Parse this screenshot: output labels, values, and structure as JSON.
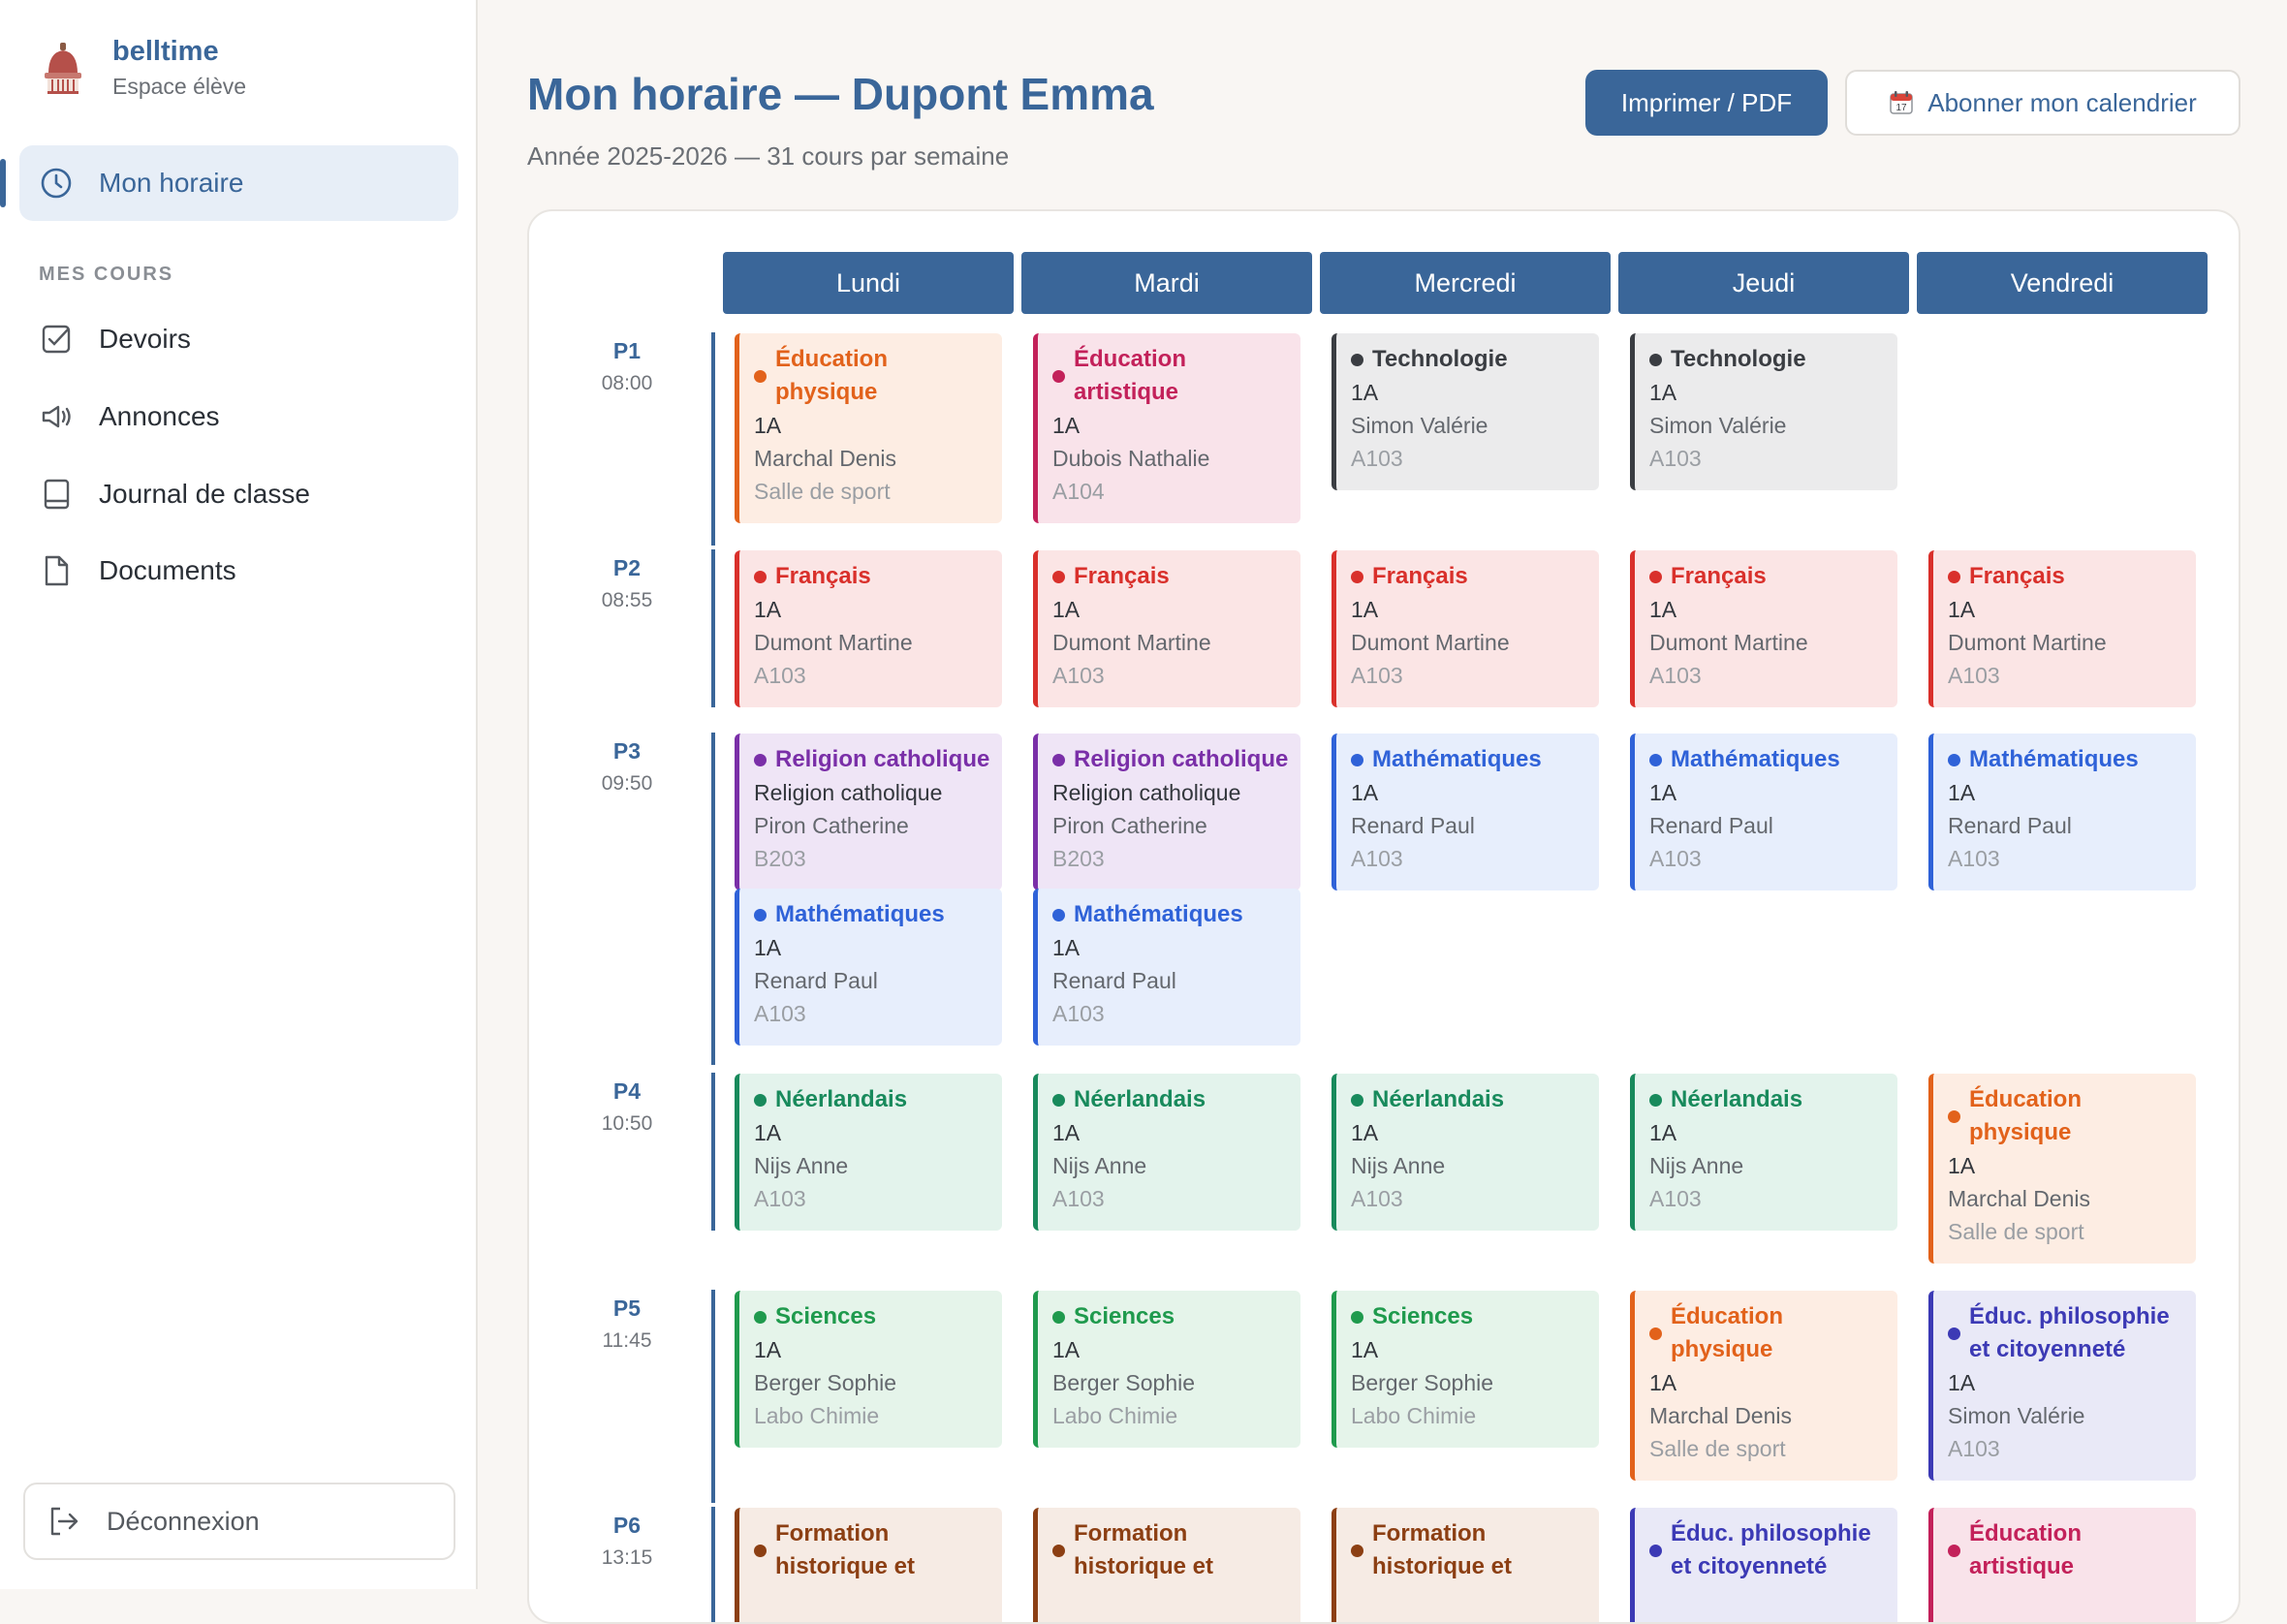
{
  "sidebar": {
    "brand_name": "belltime",
    "brand_sub": "Espace élève",
    "active_item": {
      "label": "Mon horaire",
      "icon": "clock-icon"
    },
    "section_title": "MES COURS",
    "items": [
      {
        "label": "Devoirs",
        "icon": "checkbox-icon"
      },
      {
        "label": "Annonces",
        "icon": "megaphone-icon"
      },
      {
        "label": "Journal de classe",
        "icon": "book-icon"
      },
      {
        "label": "Documents",
        "icon": "document-icon"
      }
    ],
    "logout_label": "Déconnexion"
  },
  "header": {
    "title": "Mon horaire — Dupont Emma",
    "subtitle": "Année 2025-2026 — 31 cours par semaine",
    "print_button": "Imprimer / PDF",
    "subscribe_button": "Abonner mon calendrier"
  },
  "colors": {
    "primary": "#3a6699",
    "orange": "#e2621b",
    "magenta": "#c3215a",
    "dark": "#3a3d42",
    "red": "#d9302b",
    "purple": "#7a2fa8",
    "blue": "#2f62d8",
    "green": "#188a5c",
    "lightgreen": "#1f9a4d",
    "indigo": "#3c3ab5",
    "brown": "#8c3f13"
  },
  "days": [
    "Lundi",
    "Mardi",
    "Mercredi",
    "Jeudi",
    "Vendredi"
  ],
  "periods": [
    {
      "code": "P1",
      "time": "08:00"
    },
    {
      "code": "P2",
      "time": "08:55"
    },
    {
      "code": "P3",
      "time": "09:50"
    },
    {
      "code": "P4",
      "time": "10:50"
    },
    {
      "code": "P5",
      "time": "11:45"
    },
    {
      "code": "P6",
      "time": "13:15"
    }
  ],
  "courses": [
    {
      "day": 0,
      "period": 0,
      "title_lines": [
        "Éducation",
        "physique"
      ],
      "group": "1A",
      "teacher": "Marchal Denis",
      "room": "Salle de sport",
      "color": "orange"
    },
    {
      "day": 1,
      "period": 0,
      "title_lines": [
        "Éducation",
        "artistique"
      ],
      "group": "1A",
      "teacher": "Dubois Nathalie",
      "room": "A104",
      "color": "magenta"
    },
    {
      "day": 2,
      "period": 0,
      "title_lines": [
        "Technologie"
      ],
      "group": "1A",
      "teacher": "Simon Valérie",
      "room": "A103",
      "color": "dark"
    },
    {
      "day": 3,
      "period": 0,
      "title_lines": [
        "Technologie"
      ],
      "group": "1A",
      "teacher": "Simon Valérie",
      "room": "A103",
      "color": "dark"
    },
    {
      "day": 0,
      "period": 1,
      "title_lines": [
        "Français"
      ],
      "group": "1A",
      "teacher": "Dumont Martine",
      "room": "A103",
      "color": "red"
    },
    {
      "day": 1,
      "period": 1,
      "title_lines": [
        "Français"
      ],
      "group": "1A",
      "teacher": "Dumont Martine",
      "room": "A103",
      "color": "red"
    },
    {
      "day": 2,
      "period": 1,
      "title_lines": [
        "Français"
      ],
      "group": "1A",
      "teacher": "Dumont Martine",
      "room": "A103",
      "color": "red"
    },
    {
      "day": 3,
      "period": 1,
      "title_lines": [
        "Français"
      ],
      "group": "1A",
      "teacher": "Dumont Martine",
      "room": "A103",
      "color": "red"
    },
    {
      "day": 4,
      "period": 1,
      "title_lines": [
        "Français"
      ],
      "group": "1A",
      "teacher": "Dumont Martine",
      "room": "A103",
      "color": "red"
    },
    {
      "day": 0,
      "period": 2,
      "title_lines": [
        "Religion catholique"
      ],
      "group": "Religion catholique",
      "teacher": "Piron Catherine",
      "room": "B203",
      "color": "purple"
    },
    {
      "day": 1,
      "period": 2,
      "title_lines": [
        "Religion catholique"
      ],
      "group": "Religion catholique",
      "teacher": "Piron Catherine",
      "room": "B203",
      "color": "purple"
    },
    {
      "day": 0,
      "period": 2,
      "slot": 1,
      "title_lines": [
        "Mathématiques"
      ],
      "group": "1A",
      "teacher": "Renard Paul",
      "room": "A103",
      "color": "blue"
    },
    {
      "day": 1,
      "period": 2,
      "slot": 1,
      "title_lines": [
        "Mathématiques"
      ],
      "group": "1A",
      "teacher": "Renard Paul",
      "room": "A103",
      "color": "blue"
    },
    {
      "day": 2,
      "period": 2,
      "title_lines": [
        "Mathématiques"
      ],
      "group": "1A",
      "teacher": "Renard Paul",
      "room": "A103",
      "color": "blue"
    },
    {
      "day": 3,
      "period": 2,
      "title_lines": [
        "Mathématiques"
      ],
      "group": "1A",
      "teacher": "Renard Paul",
      "room": "A103",
      "color": "blue"
    },
    {
      "day": 4,
      "period": 2,
      "title_lines": [
        "Mathématiques"
      ],
      "group": "1A",
      "teacher": "Renard Paul",
      "room": "A103",
      "color": "blue"
    },
    {
      "day": 0,
      "period": 3,
      "title_lines": [
        "Néerlandais"
      ],
      "group": "1A",
      "teacher": "Nijs Anne",
      "room": "A103",
      "color": "green"
    },
    {
      "day": 1,
      "period": 3,
      "title_lines": [
        "Néerlandais"
      ],
      "group": "1A",
      "teacher": "Nijs Anne",
      "room": "A103",
      "color": "green"
    },
    {
      "day": 2,
      "period": 3,
      "title_lines": [
        "Néerlandais"
      ],
      "group": "1A",
      "teacher": "Nijs Anne",
      "room": "A103",
      "color": "green"
    },
    {
      "day": 3,
      "period": 3,
      "title_lines": [
        "Néerlandais"
      ],
      "group": "1A",
      "teacher": "Nijs Anne",
      "room": "A103",
      "color": "green"
    },
    {
      "day": 4,
      "period": 3,
      "title_lines": [
        "Éducation",
        "physique"
      ],
      "group": "1A",
      "teacher": "Marchal Denis",
      "room": "Salle de sport",
      "color": "orange"
    },
    {
      "day": 0,
      "period": 4,
      "title_lines": [
        "Sciences"
      ],
      "group": "1A",
      "teacher": "Berger Sophie",
      "room": "Labo Chimie",
      "color": "lightgreen"
    },
    {
      "day": 1,
      "period": 4,
      "title_lines": [
        "Sciences"
      ],
      "group": "1A",
      "teacher": "Berger Sophie",
      "room": "Labo Chimie",
      "color": "lightgreen"
    },
    {
      "day": 2,
      "period": 4,
      "title_lines": [
        "Sciences"
      ],
      "group": "1A",
      "teacher": "Berger Sophie",
      "room": "Labo Chimie",
      "color": "lightgreen"
    },
    {
      "day": 3,
      "period": 4,
      "title_lines": [
        "Éducation",
        "physique"
      ],
      "group": "1A",
      "teacher": "Marchal Denis",
      "room": "Salle de sport",
      "color": "orange"
    },
    {
      "day": 4,
      "period": 4,
      "title_lines": [
        "Éduc. philosophie",
        "et citoyenneté"
      ],
      "group": "1A",
      "teacher": "Simon Valérie",
      "room": "A103",
      "color": "indigo"
    },
    {
      "day": 0,
      "period": 5,
      "title_lines": [
        "Formation",
        "historique et"
      ],
      "group": "",
      "teacher": "",
      "room": "",
      "color": "brown"
    },
    {
      "day": 1,
      "period": 5,
      "title_lines": [
        "Formation",
        "historique et"
      ],
      "group": "",
      "teacher": "",
      "room": "",
      "color": "brown"
    },
    {
      "day": 2,
      "period": 5,
      "title_lines": [
        "Formation",
        "historique et"
      ],
      "group": "",
      "teacher": "",
      "room": "",
      "color": "brown"
    },
    {
      "day": 3,
      "period": 5,
      "title_lines": [
        "Éduc. philosophie",
        "et citoyenneté"
      ],
      "group": "",
      "teacher": "",
      "room": "",
      "color": "indigo"
    },
    {
      "day": 4,
      "period": 5,
      "title_lines": [
        "Éducation",
        "artistique"
      ],
      "group": "",
      "teacher": "",
      "room": "",
      "color": "magenta"
    }
  ]
}
